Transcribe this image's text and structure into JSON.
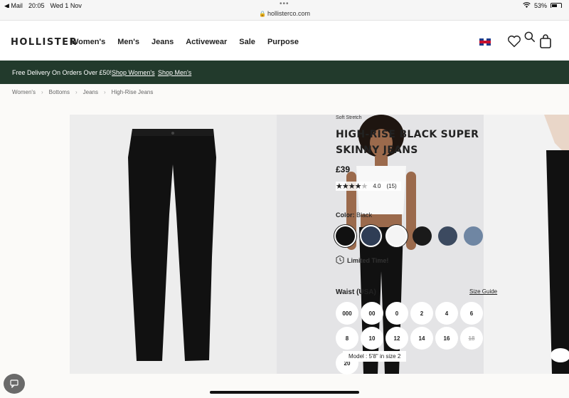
{
  "status": {
    "carrier": "◀ Mail",
    "time": "20:05",
    "date": "Wed 1 Nov",
    "battery": "53%"
  },
  "url": "hollisterco.com",
  "header": {
    "logo": "HOLLISTER",
    "nav": [
      "Women's",
      "Men's",
      "Jeans",
      "Activewear",
      "Sale",
      "Purpose"
    ]
  },
  "promo": {
    "text": "Free Delivery On Orders Over £50!",
    "link_women": "Shop Women's",
    "link_men": "Shop Men's"
  },
  "breadcrumb": [
    "Women's",
    "Bottoms",
    "Jeans",
    "High-Rise Jeans"
  ],
  "product": {
    "tag": "Soft Stretch",
    "title": "HIGH-RISE BLACK SUPER SKINNY JEANS",
    "price": "£39",
    "rating_value": "4.0",
    "rating_count": "(15)",
    "color_label": "Color:",
    "color_value": "Black",
    "swatches": [
      "#111111",
      "#2f3d55",
      "#f4f4f4",
      "#1a1a1a",
      "#3c4a60",
      "#6f86a3"
    ],
    "limited": "Limited Time!",
    "waist_label": "Waist (USA)",
    "size_guide": "Size Guide",
    "sizes": [
      "000",
      "00",
      "0",
      "2",
      "4",
      "6",
      "8",
      "10",
      "12",
      "14",
      "16",
      "18",
      "20"
    ],
    "model_note": "Model : 5'8\" in size 2"
  },
  "colors": {
    "promo_bg": "#223a2c"
  }
}
